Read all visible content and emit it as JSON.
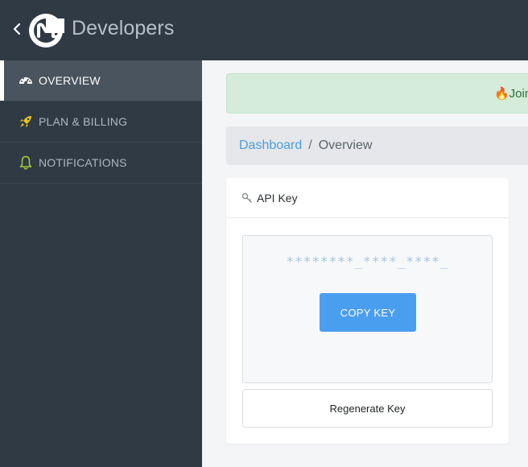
{
  "header": {
    "brand_text": "Developers",
    "back_icon": "chevron-left-icon",
    "logo_icon": "coinmarketcap-logo-icon",
    "background_color": "#2f3a44"
  },
  "sidebar": {
    "items": [
      {
        "label": "OVERVIEW",
        "icon": "dashboard-gauge-icon",
        "active": true
      },
      {
        "label": "PLAN & BILLING",
        "icon": "rocket-icon",
        "active": false
      },
      {
        "label": "NOTIFICATIONS",
        "icon": "bell-icon",
        "active": false
      }
    ]
  },
  "alert": {
    "text": "🔥Join",
    "color": "#d4ecd9"
  },
  "breadcrumb": {
    "link": "Dashboard",
    "separator": "/",
    "current": "Overview"
  },
  "api_card": {
    "title": "API Key",
    "key_icon": "key-icon",
    "key_line_1": "********_****_****_",
    "key_line_2": "****          ****",
    "copy_button": "COPY KEY",
    "regenerate_button": "Regenerate Key",
    "accent_color": "#4a9eef"
  }
}
